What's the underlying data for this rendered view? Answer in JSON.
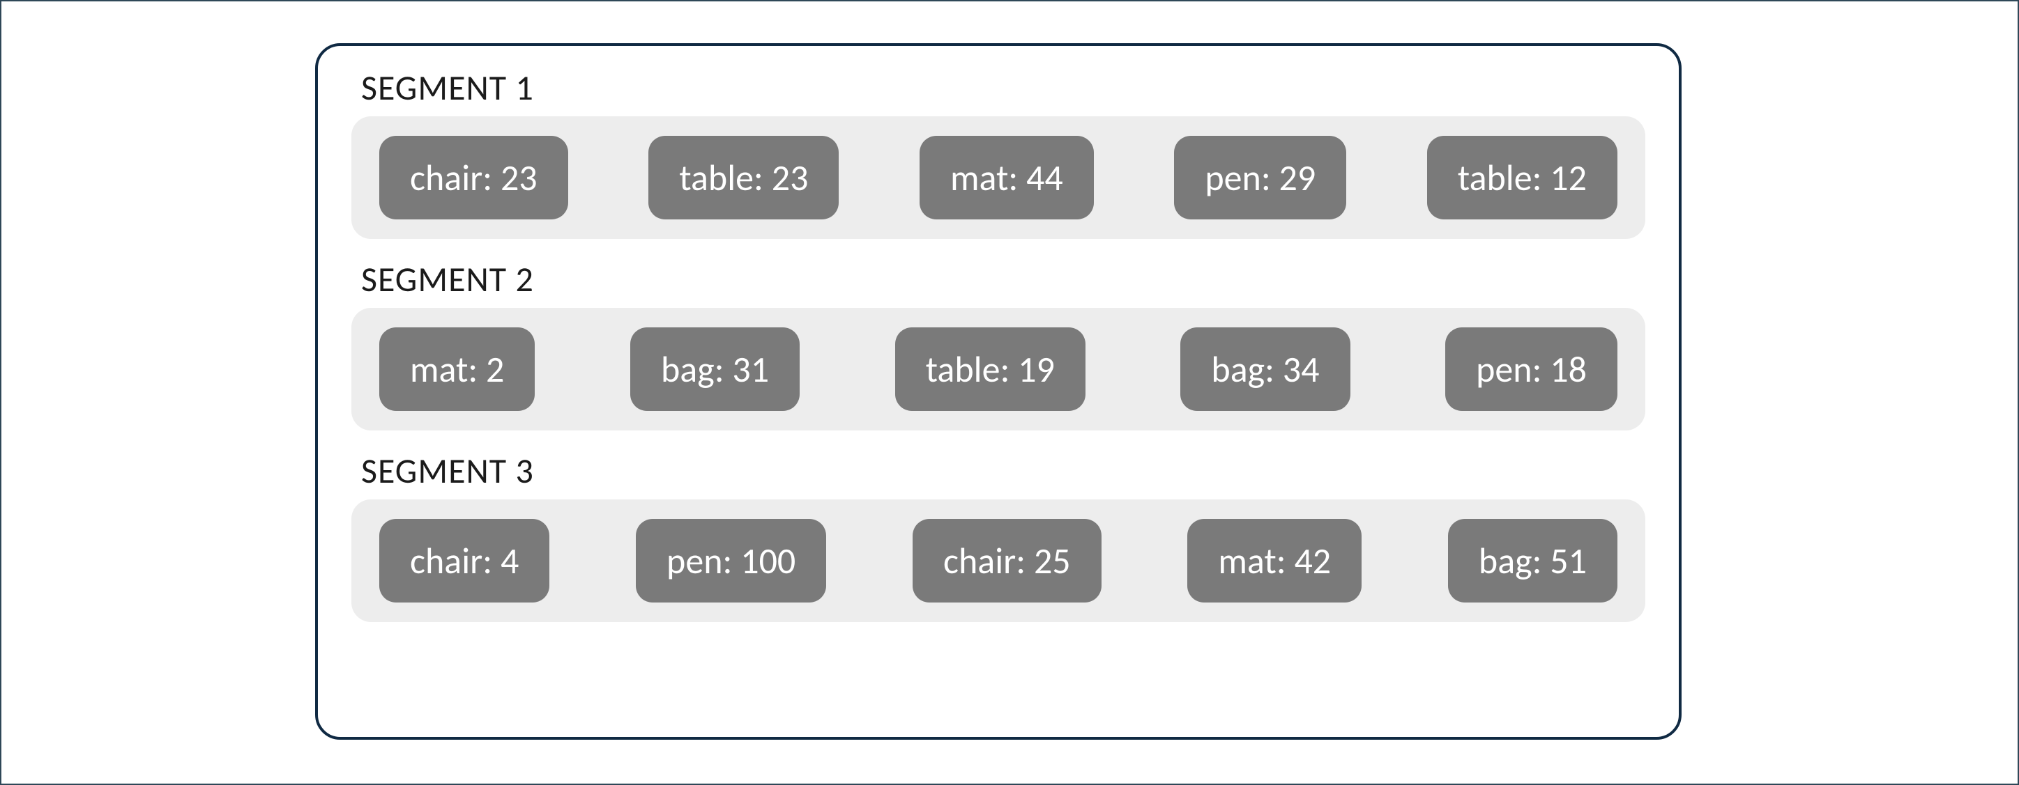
{
  "segments": [
    {
      "title": "SEGMENT 1",
      "items": [
        {
          "key": "chair",
          "value": 23,
          "label": "chair: 23"
        },
        {
          "key": "table",
          "value": 23,
          "label": "table: 23"
        },
        {
          "key": "mat",
          "value": 44,
          "label": "mat: 44"
        },
        {
          "key": "pen",
          "value": 29,
          "label": "pen: 29"
        },
        {
          "key": "table",
          "value": 12,
          "label": "table: 12"
        }
      ]
    },
    {
      "title": "SEGMENT 2",
      "items": [
        {
          "key": "mat",
          "value": 2,
          "label": "mat: 2"
        },
        {
          "key": "bag",
          "value": 31,
          "label": "bag: 31"
        },
        {
          "key": "table",
          "value": 19,
          "label": "table: 19"
        },
        {
          "key": "bag",
          "value": 34,
          "label": "bag: 34"
        },
        {
          "key": "pen",
          "value": 18,
          "label": "pen: 18"
        }
      ]
    },
    {
      "title": "SEGMENT 3",
      "items": [
        {
          "key": "chair",
          "value": 4,
          "label": "chair: 4"
        },
        {
          "key": "pen",
          "value": 100,
          "label": "pen: 100"
        },
        {
          "key": "chair",
          "value": 25,
          "label": "chair: 25"
        },
        {
          "key": "mat",
          "value": 42,
          "label": "mat: 42"
        },
        {
          "key": "bag",
          "value": 51,
          "label": "bag: 51"
        }
      ]
    }
  ]
}
